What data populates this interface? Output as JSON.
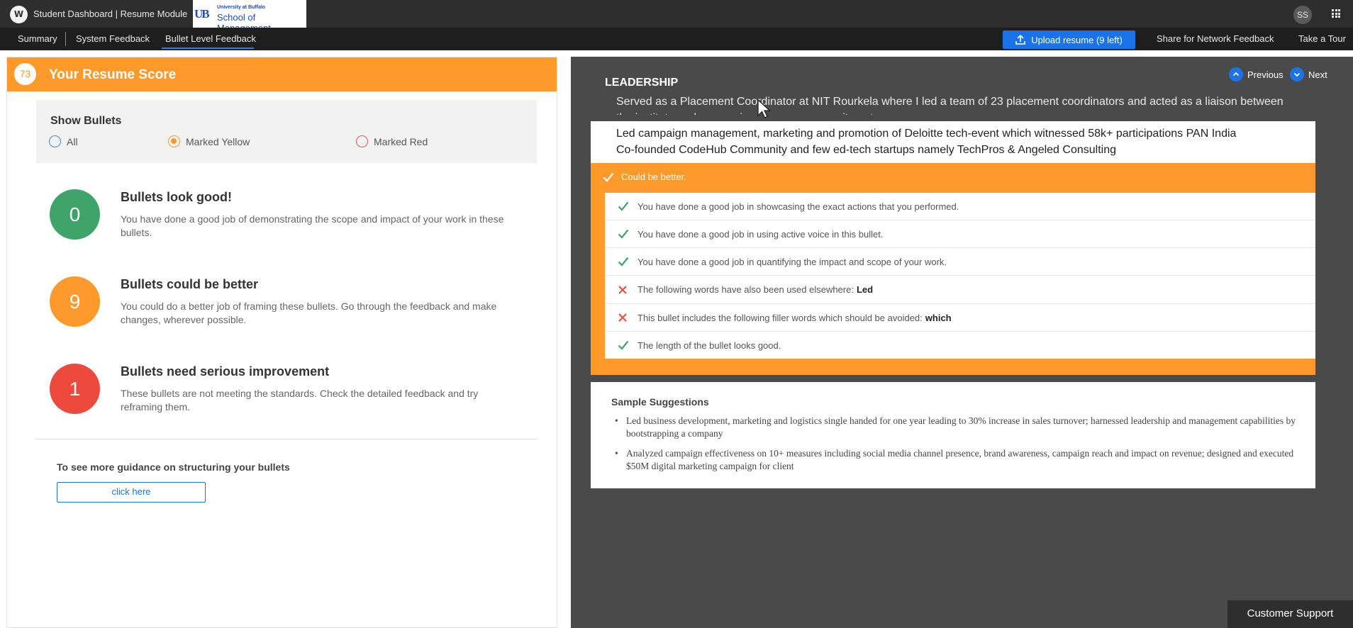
{
  "topbar": {
    "logo_letter": "W",
    "title": "Student Dashboard | Resume Module",
    "ub_logo_small": "University at Buffalo",
    "ub_logo_large": "School of Management",
    "avatar_initials": "SS"
  },
  "nav": {
    "tabs": [
      {
        "label": "Summary"
      },
      {
        "label": "System Feedback"
      },
      {
        "label": "Bullet Level Feedback",
        "active": true
      }
    ],
    "upload_label": "Upload resume (9 left)",
    "share_label": "Share for Network Feedback",
    "tour_label": "Take a Tour"
  },
  "left": {
    "score": "73",
    "score_title": "Your Resume Score",
    "show_bullets": {
      "label": "Show Bullets",
      "options": [
        "All",
        "Marked Yellow",
        "Marked Red"
      ],
      "selected": "Marked Yellow"
    },
    "stats": [
      {
        "count": "0",
        "title": "Bullets look good!",
        "desc": "You have done a good job of demonstrating the scope and impact of your work in these bullets.",
        "color": "#3ea46a"
      },
      {
        "count": "9",
        "title": "Bullets could be better",
        "desc": "You could do a better job of framing these bullets. Go through the feedback and make changes, wherever possible.",
        "color": "#fd9a2b"
      },
      {
        "count": "1",
        "title": "Bullets need serious improvement",
        "desc": "These bullets are not meeting the standards. Check the detailed feedback and try reframing them.",
        "color": "#ec4a3c"
      }
    ],
    "guidance_text": "To see more guidance on structuring your bullets",
    "click_here": "click here"
  },
  "right": {
    "prev_label": "Previous",
    "next_label": "Next",
    "section_title": "LEADERSHIP",
    "prev_bullet": "Served as a Placement Coordinator at NIT Rourkela where I led a team of 23 placement coordinators and acted as a liaison between the institute and companies for campus recruitments",
    "bullet_lines": [
      "Led campaign management, marketing and promotion of Deloitte tech-event which witnessed 58k+ participations PAN India",
      "Co-founded CodeHub Community and few ed-tech startups namely TechPros & Angeled Consulting"
    ],
    "feedback_header": "Could be better.",
    "feedback": [
      {
        "status": "ok",
        "text": "You have done a good job in showcasing the exact actions that you performed.",
        "bold": ""
      },
      {
        "status": "ok",
        "text": "You have done a good job in using active voice in this bullet.",
        "bold": ""
      },
      {
        "status": "ok",
        "text": "You have done a good job in quantifying the impact and scope of your work.",
        "bold": ""
      },
      {
        "status": "bad",
        "text": "The following words have also been used elsewhere:",
        "bold": "Led"
      },
      {
        "status": "bad",
        "text": "This bullet includes the following filler words which should be avoided:",
        "bold": "which"
      },
      {
        "status": "ok",
        "text": "The length of the bullet looks good.",
        "bold": ""
      }
    ],
    "suggestions_title": "Sample Suggestions",
    "suggestions": [
      "Led business development, marketing and logistics single handed for one year leading to 30% increase in sales turnover; harnessed leadership and management capabilities by bootstrapping a company",
      "Analyzed campaign effectiveness on 10+ measures including social media channel presence, brand awareness, campaign reach and impact on revenue; designed and executed $50M digital marketing campaign for client"
    ]
  },
  "support_label": "Customer Support",
  "colors": {
    "accent_orange": "#fd9a2b",
    "accent_blue": "#1a73e8",
    "ok_green": "#3ea46a",
    "bad_red": "#ec4a3c"
  }
}
